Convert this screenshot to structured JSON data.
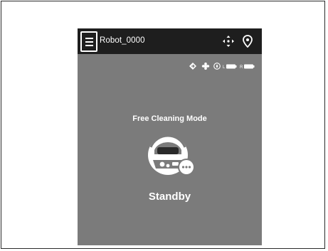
{
  "header": {
    "device_name": "Robot_0000",
    "menu_icon": "hamburger-menu-icon",
    "remote_icon": "direction-pad-icon",
    "map_icon": "location-pin-icon"
  },
  "status_bar": {
    "icons": [
      "suction-power-icon",
      "fan-icon",
      "water-level-icon",
      "left-battery-icon",
      "right-battery-icon"
    ],
    "left_label": "L",
    "right_label": "R"
  },
  "main": {
    "mode_label": "Free Cleaning Mode",
    "state_label": "Standby",
    "robot_icon": "robot-cleaner-icon",
    "more_icon": "more-options-icon"
  },
  "colors": {
    "appbar": "#1e1e1e",
    "screen": "#7b7b7b",
    "text": "#ffffff"
  }
}
